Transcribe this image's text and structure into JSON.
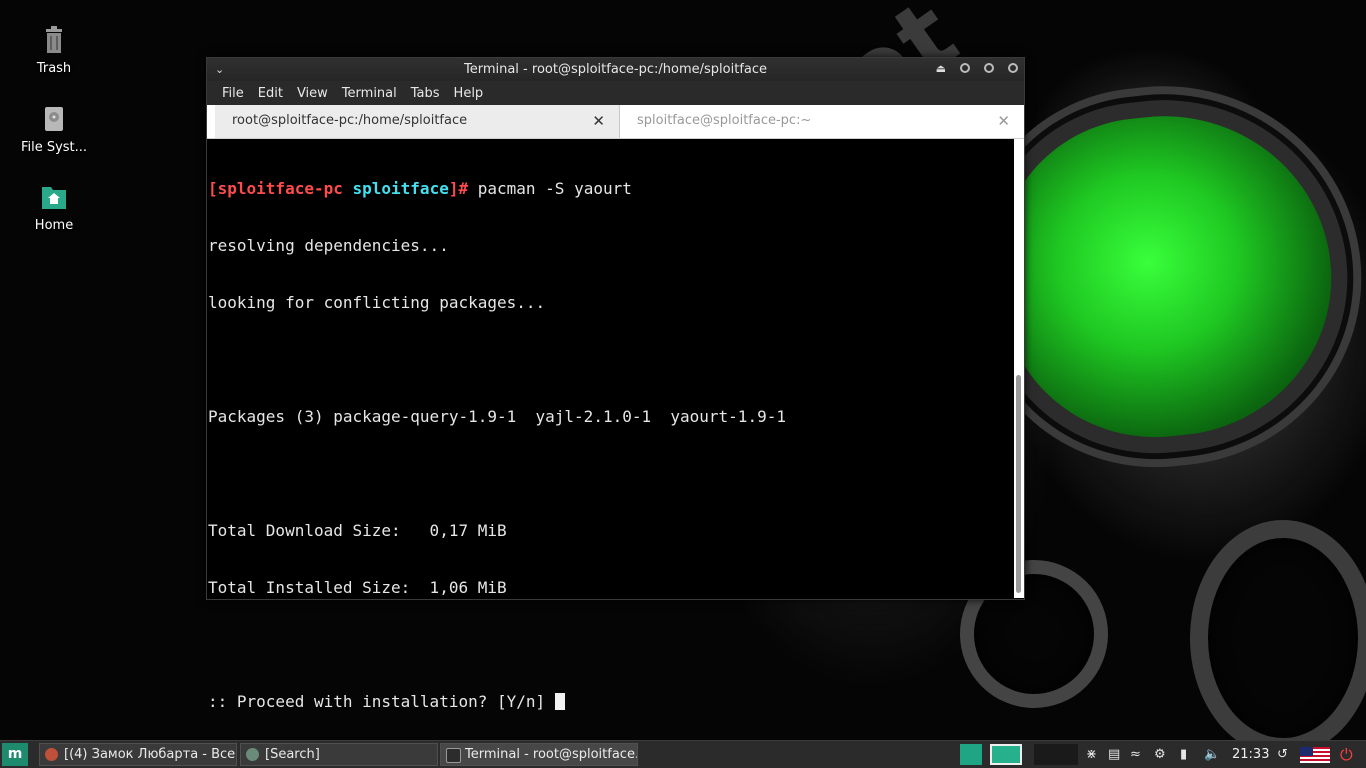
{
  "desktop": {
    "icons": [
      {
        "label": "Trash"
      },
      {
        "label": "File Syst..."
      },
      {
        "label": "Home"
      }
    ],
    "watermark": "codeby.net"
  },
  "terminal": {
    "title": "Terminal - root@sploitface-pc:/home/sploitface",
    "menu": [
      "File",
      "Edit",
      "View",
      "Terminal",
      "Tabs",
      "Help"
    ],
    "tabs": [
      {
        "label": "root@sploitface-pc:/home/sploitface",
        "active": true
      },
      {
        "label": "sploitface@sploitface-pc:~",
        "active": false
      }
    ],
    "prompt": {
      "host_part": "[sploitface-pc",
      "dir_part": "sploitface",
      "end_part": "]#",
      "command": "pacman -S yaourt"
    },
    "output": [
      "resolving dependencies...",
      "looking for conflicting packages...",
      "",
      "Packages (3) package-query-1.9-1  yajl-2.1.0-1  yaourt-1.9-1",
      "",
      "Total Download Size:   0,17 MiB",
      "Total Installed Size:  1,06 MiB",
      "",
      ":: Proceed with installation? [Y/n] "
    ]
  },
  "taskbar": {
    "start_label": "m",
    "tasks": [
      {
        "label": "[(4) Замок Любарта - Все ..."
      },
      {
        "label": "[Search]"
      },
      {
        "label": "Terminal - root@sploitface..."
      }
    ],
    "clock": "21:33"
  },
  "colors": {
    "prompt_red": "#ff4b4b",
    "prompt_cyan": "#43e0f0",
    "accent_green": "#1e8b6f",
    "goggle_green": "#39ff3b"
  }
}
